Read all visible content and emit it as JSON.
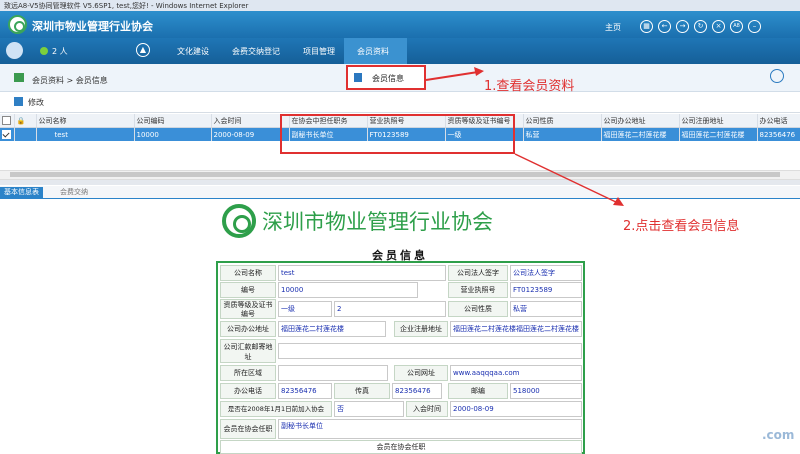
{
  "window": {
    "title": "致远A8-V5协同管理软件 V5.6SP1, test,您好! - Windows Internet Explorer"
  },
  "header": {
    "app_title": "深圳市物业管理行业协会",
    "home_label": "主页",
    "icons": [
      "window-icon",
      "back-icon",
      "forward-icon",
      "refresh-icon",
      "close-icon",
      "a8-icon",
      "minimize-icon"
    ]
  },
  "nav": {
    "online_count": "2 人",
    "items": [
      "文化建设",
      "会费交纳登记",
      "项目管理",
      "会员资料"
    ],
    "active_item": "会员资料",
    "dropdown_item": "会员信息"
  },
  "breadcrumb": "会员资料 > 会员信息",
  "toolbar": {
    "edit_label": "修改"
  },
  "grid": {
    "columns": [
      "",
      "",
      "公司名称",
      "公司编码",
      "入会时间",
      "在协会中担任职务",
      "营业执照号",
      "资质等级及证书编号",
      "公司性质",
      "公司办公地址",
      "公司注册地址",
      "办公电话"
    ],
    "rows": [
      [
        "",
        "",
        "test",
        "10000",
        "2000-08-09",
        "副秘书长单位",
        "FT0123589",
        "一级",
        "私营",
        "福田莲花二村莲花楼",
        "福田莲花二村莲花楼",
        "82356476"
      ]
    ]
  },
  "tabs": [
    "基本信息表",
    "会费交纳"
  ],
  "annotations": {
    "step1": "1.查看会员资料",
    "step2": "2.点击查看会员信息"
  },
  "form": {
    "association_name": "深圳市物业管理行业协会",
    "title": "会员信息",
    "labels": {
      "company_name": "公司名称",
      "legal_rep_sign": "公司法人签字",
      "code": "编号",
      "license": "营业执照号",
      "qualification": "资质等级及证书编号",
      "nature": "公司性质",
      "office_address": "公司办公地址",
      "registered_address": "企业注册地址",
      "mailing_address": "公司汇款邮寄地址",
      "region": "所在区域",
      "website": "公司网址",
      "office_phone": "办公电话",
      "fax": "传真",
      "postcode": "邮编",
      "joined_2008": "是否在2008年1月1日前加入协会",
      "join_date": "入会时间",
      "position": "会员在协会任职",
      "position_section": "会员在协会任职"
    },
    "values": {
      "company_name": "test",
      "legal_rep_sign": "公司法人签字",
      "code": "10000",
      "license": "FT0123589",
      "qualification_level": "一级",
      "qualification_cert": "2",
      "nature": "私营",
      "office_address": "福田莲花二村莲花楼",
      "registered_address": "福田莲花二村莲花楼福田莲花二村莲花楼",
      "mailing_address": "",
      "region": "",
      "website": "www.aaqqqaa.com",
      "office_phone": "82356476",
      "fax": "82356476",
      "postcode": "518000",
      "joined_2008": "否",
      "join_date": "2000-08-09",
      "position": "副秘书长单位"
    }
  },
  "watermark": ".com"
}
